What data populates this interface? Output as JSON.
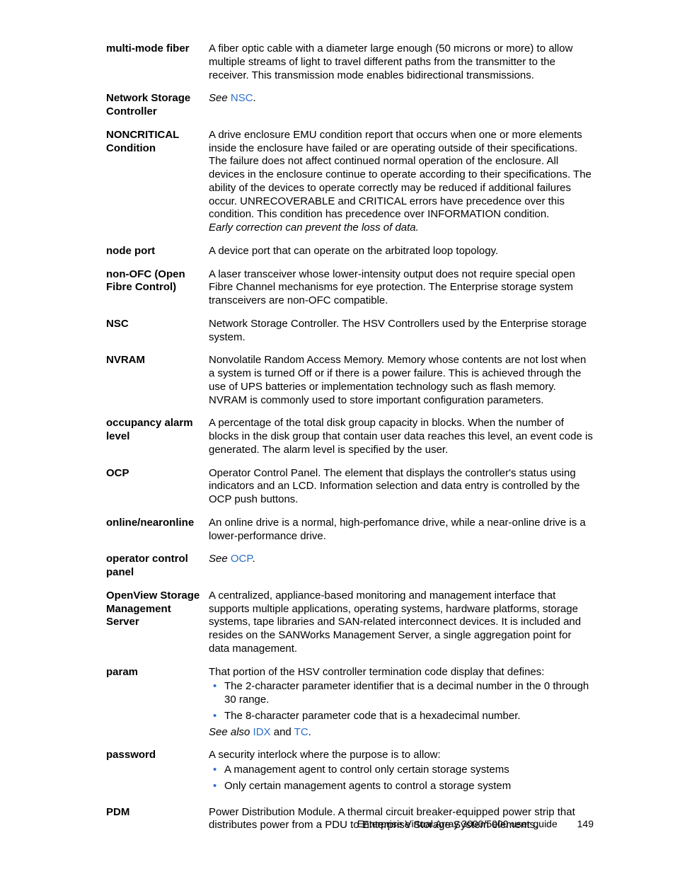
{
  "entries": [
    {
      "term": "multi-mode fiber",
      "def_plain": "A fiber optic cable with a diameter large enough (50 microns or more) to allow multiple streams of light to travel different paths from the transmitter to the receiver. This transmission mode enables bidirectional transmissions."
    },
    {
      "term": "Network Storage Controller",
      "see_prefix": "See ",
      "see_link": "NSC",
      "see_suffix": "."
    },
    {
      "term": "NONCRITICAL Condition",
      "def_plain": "A drive enclosure EMU condition report that occurs when one or more elements inside the enclosure have failed or are operating outside of their specifications. The failure does not affect continued normal operation of the enclosure. All devices in the enclosure continue to operate according to their specifications. The ability of the devices to operate correctly may be reduced if additional failures occur. UNRECOVERABLE and CRITICAL errors have precedence over this condition. This condition has precedence over INFORMATION condition.",
      "trailing_italic": "Early correction can prevent the loss of data."
    },
    {
      "term": "node port",
      "def_plain": "A device port that can operate on the arbitrated loop topology."
    },
    {
      "term": "non-OFC (Open Fibre Control)",
      "def_plain": "A laser transceiver whose lower-intensity output does not require special open Fibre Channel mechanisms for eye protection. The Enterprise storage system transceivers are non-OFC compatible."
    },
    {
      "term": "NSC",
      "def_plain": "Network Storage Controller. The HSV Controllers used by the Enterprise storage system."
    },
    {
      "term": "NVRAM",
      "def_plain": "Nonvolatile Random Access Memory. Memory whose contents are not lost when a system is turned Off or if there is a power failure. This is achieved through the use of UPS batteries or implementation technology such as flash memory. NVRAM is commonly used to store important configuration parameters."
    },
    {
      "term": "occupancy alarm level",
      "def_plain": "A percentage of the total disk group capacity in blocks. When the number of blocks in the disk group that contain user data reaches this level, an event code is generated. The alarm level is specified by the user."
    },
    {
      "term": "OCP",
      "def_plain": "Operator Control Panel. The element that displays the controller's status using indicators and an LCD. Information selection and data entry is controlled by the OCP push buttons."
    },
    {
      "term": "online/nearonline",
      "def_plain": "An online drive is a normal, high-perfomance drive, while a near-online drive is a lower-performance drive."
    },
    {
      "term": "operator control panel",
      "see_prefix": "See ",
      "see_link": "OCP",
      "see_suffix": "."
    },
    {
      "term": "OpenView Storage Management Server",
      "def_plain": "A centralized, appliance-based monitoring and management interface that supports multiple applications, operating systems, hardware platforms, storage systems, tape libraries and SAN-related interconnect devices. It is included and resides on the SANWorks Management Server, a single aggregation point for data management."
    },
    {
      "term": "param",
      "def_plain": "That portion of the HSV controller termination code display that defines:",
      "bullets": [
        "The 2-character parameter identifier that is a decimal number in the 0 through 30 range.",
        "The 8-character parameter code that is a hexadecimal number."
      ],
      "see_also_prefix": "See also ",
      "see_also_links": [
        "IDX",
        "TC"
      ],
      "see_also_joiner": " and ",
      "see_also_suffix": "."
    },
    {
      "term": "password",
      "def_plain": "A security interlock where the purpose is to allow:",
      "bullets": [
        "A management agent to control only certain storage systems",
        "Only certain management agents to control a storage system"
      ]
    },
    {
      "term": "PDM",
      "def_plain": "Power Distribution Module. A thermal circuit breaker-equipped power strip that distributes power from a PDU to Enterprise Storage System elements."
    }
  ],
  "footer": {
    "title": "Enterprise Virtual Array 3000/5000 user guide",
    "page": "149"
  }
}
